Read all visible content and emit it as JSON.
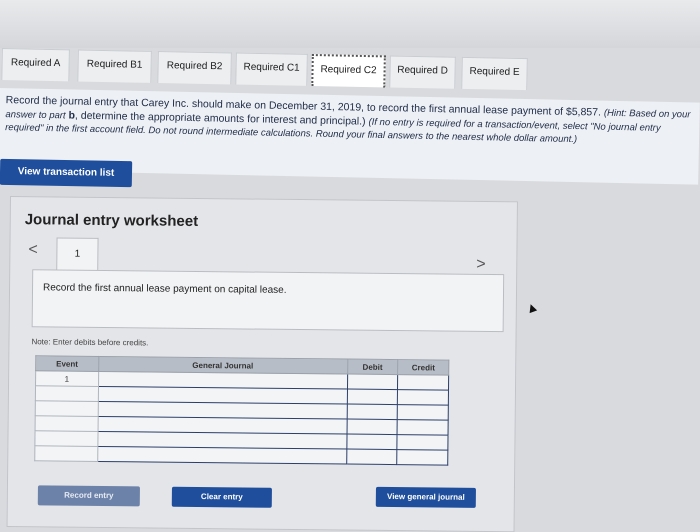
{
  "tabs": [
    {
      "label": "Required A"
    },
    {
      "label": "Required B1"
    },
    {
      "label": "Required B2"
    },
    {
      "label": "Required C1"
    },
    {
      "label": "Required C2",
      "active": true
    },
    {
      "label": "Required D"
    },
    {
      "label": "Required E"
    }
  ],
  "instructions": {
    "part1": "Record the journal entry that Carey Inc. should make on December 31, 2019, to record the first annual lease payment of $5,857.",
    "hint": "(Hint: Based on your answer to part",
    "bold_b": "b",
    "part2": ", determine the appropriate amounts for interest and principal.)",
    "part3": "(If no entry is required for a transaction/event, select \"No journal entry required\" in the first account field. Do not round intermediate calculations. Round your final answers to the nearest whole dollar amount.)"
  },
  "view_transaction_list": "View transaction list",
  "worksheet": {
    "title": "Journal entry worksheet",
    "entry_number": "1",
    "prev_icon": "<",
    "next_icon": ">",
    "description": "Record the first annual lease payment on capital lease.",
    "note": "Note: Enter debits before credits.",
    "columns": {
      "event": "Event",
      "general_journal": "General Journal",
      "debit": "Debit",
      "credit": "Credit"
    },
    "rows": [
      {
        "event": "1",
        "account": "",
        "debit": "",
        "credit": ""
      },
      {
        "event": "",
        "account": "",
        "debit": "",
        "credit": ""
      },
      {
        "event": "",
        "account": "",
        "debit": "",
        "credit": ""
      },
      {
        "event": "",
        "account": "",
        "debit": "",
        "credit": ""
      },
      {
        "event": "",
        "account": "",
        "debit": "",
        "credit": ""
      },
      {
        "event": "",
        "account": "",
        "debit": "",
        "credit": ""
      }
    ],
    "buttons": {
      "record_entry": "Record entry",
      "clear_entry": "Clear entry",
      "view_general_journal": "View general journal"
    }
  },
  "colors": {
    "accent_blue": "#1f4f9c",
    "disabled_blue": "#6d82a9",
    "header_gray": "#b7bdc6"
  }
}
